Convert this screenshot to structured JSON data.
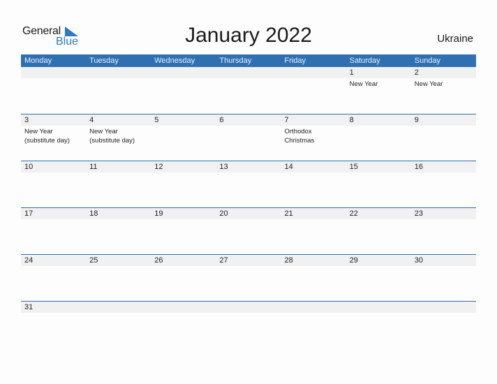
{
  "logo": {
    "line1": "General",
    "line2": "Blue",
    "accent": "#2a7bc4"
  },
  "header": {
    "title": "January 2022",
    "country": "Ukraine"
  },
  "colors": {
    "header_bg": "#2e70b2",
    "date_strip": "#f1f1f1"
  },
  "weekdays": [
    "Monday",
    "Tuesday",
    "Wednesday",
    "Thursday",
    "Friday",
    "Saturday",
    "Sunday"
  ],
  "weeks": [
    [
      {
        "d": ""
      },
      {
        "d": ""
      },
      {
        "d": ""
      },
      {
        "d": ""
      },
      {
        "d": ""
      },
      {
        "d": "1",
        "e": "New Year"
      },
      {
        "d": "2",
        "e": "New Year"
      }
    ],
    [
      {
        "d": "3",
        "e": "New Year\n(substitute day)"
      },
      {
        "d": "4",
        "e": "New Year\n(substitute day)"
      },
      {
        "d": "5"
      },
      {
        "d": "6"
      },
      {
        "d": "7",
        "e": "Orthodox\nChristmas"
      },
      {
        "d": "8"
      },
      {
        "d": "9"
      }
    ],
    [
      {
        "d": "10"
      },
      {
        "d": "11"
      },
      {
        "d": "12"
      },
      {
        "d": "13"
      },
      {
        "d": "14"
      },
      {
        "d": "15"
      },
      {
        "d": "16"
      }
    ],
    [
      {
        "d": "17"
      },
      {
        "d": "18"
      },
      {
        "d": "19"
      },
      {
        "d": "20"
      },
      {
        "d": "21"
      },
      {
        "d": "22"
      },
      {
        "d": "23"
      }
    ],
    [
      {
        "d": "24"
      },
      {
        "d": "25"
      },
      {
        "d": "26"
      },
      {
        "d": "27"
      },
      {
        "d": "28"
      },
      {
        "d": "29"
      },
      {
        "d": "30"
      }
    ],
    [
      {
        "d": "31"
      },
      {
        "d": ""
      },
      {
        "d": ""
      },
      {
        "d": ""
      },
      {
        "d": ""
      },
      {
        "d": ""
      },
      {
        "d": ""
      }
    ]
  ]
}
